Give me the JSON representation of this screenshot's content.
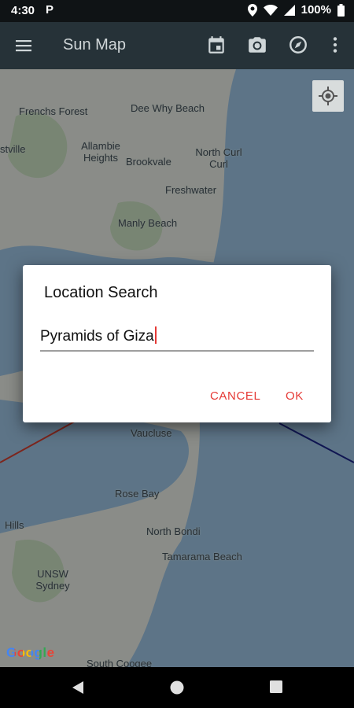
{
  "status_bar": {
    "time": "4:30",
    "app_badge": "P",
    "battery": "100%",
    "icons": [
      "location-icon",
      "wifi-icon",
      "signal-icon",
      "battery-icon"
    ]
  },
  "toolbar": {
    "title": "Sun Map",
    "icons": [
      "menu-icon",
      "calendar-icon",
      "camera-icon",
      "compass-icon",
      "more-vert-icon"
    ]
  },
  "map": {
    "labels": [
      "Frenchs Forest",
      "Dee Why Beach",
      "stville",
      "Allambie Heights",
      "Brookvale",
      "North Curl Curl",
      "Freshwater",
      "Manly Beach",
      "Vaucluse",
      "Rose Bay",
      "North Bondi",
      "Tamarama Beach",
      "Hills",
      "UNSW Sydney",
      "South Coogee"
    ],
    "attribution": "Google"
  },
  "dialog": {
    "title": "Location Search",
    "input_value": "Pyramids of Giza",
    "cancel_label": "CANCEL",
    "ok_label": "OK"
  },
  "colors": {
    "toolbar": "#263238",
    "accent": "#e53935",
    "sea": "#8fb3d0",
    "land": "#d5d8d3"
  }
}
